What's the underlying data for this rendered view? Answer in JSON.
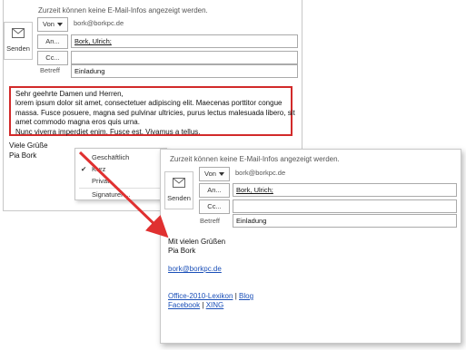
{
  "info_text": "Zurzeit können keine E-Mail-Infos angezeigt werden.",
  "send_label": "Senden",
  "from_label": "Von",
  "from_value": "bork@borkpc.de",
  "to_label": "An...",
  "to_value": "Bork, Ulrich;",
  "cc_label": "Cc...",
  "subject_label": "Betreff",
  "subject_value": "Einladung",
  "window1": {
    "body_lines": [
      "Sehr geehrte Damen und Herren,",
      "lorem ipsum dolor sit amet, consectetuer adipiscing elit. Maecenas porttitor congue",
      "massa. Fusce posuere, magna sed pulvinar ultricies, purus lectus malesuada libero, sit",
      "amet commodo magna eros quis urna.",
      "Nunc viverra imperdiet enim. Fusce est. Vivamus a tellus."
    ],
    "signature_line1": "Viele Grüße",
    "signature_line2": "Pia Bork",
    "menu": {
      "items": [
        "Geschäftlich",
        "Kurz",
        "Privat",
        "Signaturen..."
      ],
      "checked_item": "Kurz",
      "check_mark": "✔"
    }
  },
  "window2": {
    "greeting": "Mit vielen Grüßen",
    "name": "Pia Bork",
    "email_link": "bork@borkpc.de",
    "link_office": "Office-2010-Lexikon",
    "link_blog": "Blog",
    "link_facebook": "Facebook",
    "link_xing": "XING",
    "separator": "|"
  },
  "colors": {
    "highlight_border": "#d22a2a",
    "arrow": "#e03030",
    "link": "#1a4fb8"
  }
}
